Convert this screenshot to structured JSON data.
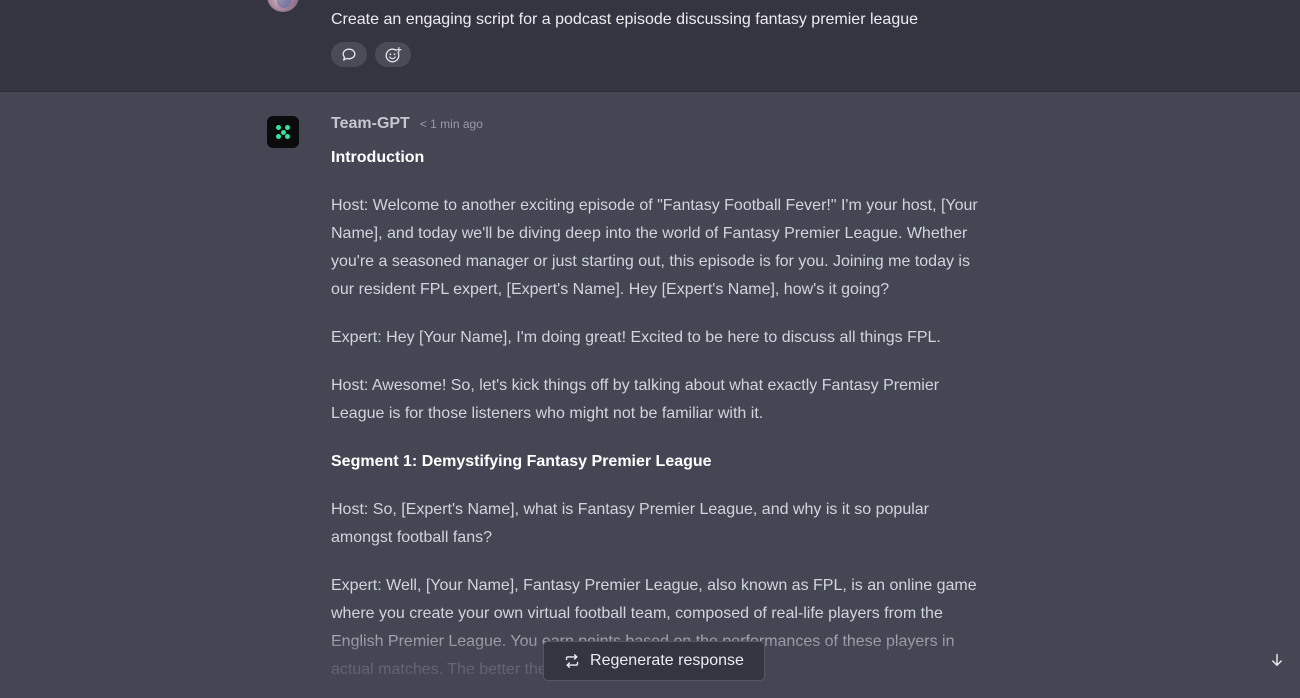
{
  "user_message": {
    "text": "Create an engaging script for a podcast episode discussing fantasy premier league",
    "actions": [
      {
        "icon": "comment-icon"
      },
      {
        "icon": "add-reaction-icon"
      }
    ]
  },
  "assistant_message": {
    "name": "Team-GPT",
    "timestamp": "< 1 min ago",
    "paragraphs": [
      {
        "text": "Introduction",
        "heading": true
      },
      {
        "text": "Host: Welcome to another exciting episode of \"Fantasy Football Fever!\" I'm your host, [Your Name], and today we'll be diving deep into the world of Fantasy Premier League. Whether you're a seasoned manager or just starting out, this episode is for you. Joining me today is our resident FPL expert, [Expert's Name]. Hey [Expert's Name], how's it going?"
      },
      {
        "text": "Expert: Hey [Your Name], I'm doing great! Excited to be here to discuss all things FPL."
      },
      {
        "text": "Host: Awesome! So, let's kick things off by talking about what exactly Fantasy Premier League is for those listeners who might not be familiar with it."
      },
      {
        "text": "Segment 1: Demystifying Fantasy Premier League",
        "heading": true
      },
      {
        "text": "Host: So, [Expert's Name], what is Fantasy Premier League, and why is it so popular amongst football fans?"
      },
      {
        "text": "Expert: Well, [Your Name], Fantasy Premier League, also known as FPL, is an online game where you create your own virtual football team, composed of real-life players from the English Premier League. You earn points based on the performances of these players in actual matches. The better they perform, the more points you"
      }
    ]
  },
  "regenerate_button": {
    "label": "Regenerate response",
    "icon": "regenerate-icon"
  },
  "scroll_button": {
    "icon": "arrow-down-icon"
  },
  "colors": {
    "user_bg": "#343541",
    "assistant_bg": "#444654",
    "accent": "#2ee6a0"
  }
}
